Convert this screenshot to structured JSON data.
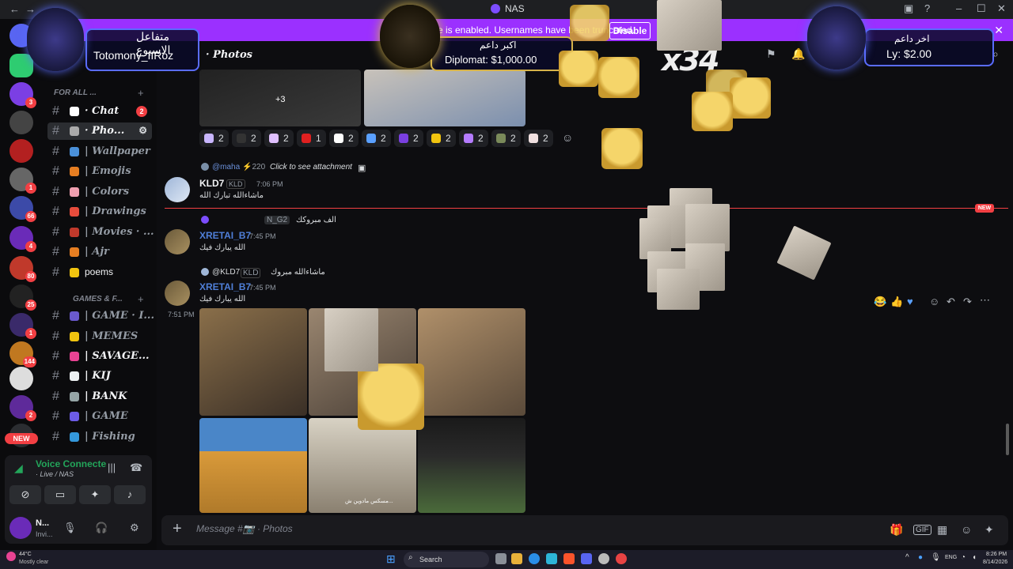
{
  "titlebar": {
    "back": "←",
    "forward": "→",
    "app_name": "NAS",
    "minimize": "–",
    "maximize": "☐",
    "close": "✕"
  },
  "banner": {
    "text": "e is enabled. Usernames have been truncated.",
    "button": "Disable",
    "close": "✕"
  },
  "rail": {
    "servers": [
      {
        "badge": "",
        "color": "#5865f2"
      },
      {
        "badge": "",
        "color": "#2ecc71"
      },
      {
        "badge": "3",
        "color": "#7b3fe4"
      },
      {
        "badge": "",
        "color": "#444444"
      },
      {
        "badge": "",
        "color": "#b32020"
      },
      {
        "badge": "1",
        "color": "#666666"
      },
      {
        "badge": "66",
        "color": "#3c4aa8"
      },
      {
        "badge": "4",
        "color": "#6a2bb8"
      },
      {
        "badge": "80",
        "color": "#c0392b"
      },
      {
        "badge": "25",
        "color": "#222222"
      },
      {
        "badge": "1",
        "color": "#3a2a6a"
      },
      {
        "badge": "144",
        "color": "#c07820"
      },
      {
        "badge": "",
        "color": "#dddddd"
      },
      {
        "badge": "2",
        "color": "#5e2a9a"
      },
      {
        "badge": "",
        "color": "#2b2d31"
      }
    ],
    "new_label": "NEW"
  },
  "sidebar": {
    "cat1": "FOR ALL ...",
    "cat2": "GAMES & F...",
    "plus": "+",
    "channels": [
      {
        "label": "· Chat",
        "badge": "2",
        "emo": "#ffffff"
      },
      {
        "label": "· Pho...",
        "badge": "",
        "emo": "#aaaaaa"
      },
      {
        "label": "| Wallpaper",
        "badge": "",
        "emo": "#4a90d9"
      },
      {
        "label": "| Emojis",
        "badge": "",
        "emo": "#e67e22"
      },
      {
        "label": "| Colors",
        "badge": "",
        "emo": "#f0a0b0"
      },
      {
        "label": "| Drawings",
        "badge": "",
        "emo": "#e74c3c"
      },
      {
        "label": "| Movies · ...",
        "badge": "",
        "emo": "#c0392b"
      },
      {
        "label": "| Ajr",
        "badge": "",
        "emo": "#e67e22"
      },
      {
        "label": "poems",
        "badge": "",
        "emo": "#f1c40f"
      },
      {
        "label": "| GAME · I...",
        "badge": "",
        "emo": "#6a5acd"
      },
      {
        "label": "| MEMES",
        "badge": "",
        "emo": "#f1c40f"
      },
      {
        "label": "| SAVAGE...",
        "badge": "",
        "emo": "#e84393"
      },
      {
        "label": "| KIJ",
        "badge": "",
        "emo": "#ecf0f1"
      },
      {
        "label": "| BANK",
        "badge": "",
        "emo": "#95a5a6"
      },
      {
        "label": "| GAME",
        "badge": "",
        "emo": "#6c5ce7"
      },
      {
        "label": "| Fishing",
        "badge": "",
        "emo": "#3498db"
      }
    ]
  },
  "voice": {
    "status": "Voice Connecte",
    "channel": "· Live / NAS",
    "user_name": "N...",
    "user_status": "Invi..."
  },
  "header": {
    "channel": "· Photos"
  },
  "reactions": [
    {
      "count": "2",
      "color": "#c9b6ff"
    },
    {
      "count": "2",
      "color": "#333333"
    },
    {
      "count": "2",
      "color": "#e0c0ff"
    },
    {
      "count": "1",
      "color": "#e02020"
    },
    {
      "count": "2",
      "color": "#ffffff"
    },
    {
      "count": "2",
      "color": "#5aa0ff"
    },
    {
      "count": "2",
      "color": "#7a3fe0"
    },
    {
      "count": "2",
      "color": "#f1c40f"
    },
    {
      "count": "2",
      "color": "#b57cff"
    },
    {
      "count": "2",
      "color": "#7a8a5a"
    },
    {
      "count": "2",
      "color": "#f0e0e0"
    }
  ],
  "messages": {
    "m1_reply_user": "@maha",
    "m1_reply_badge": "⚡220",
    "m1_reply_text": "Click to see attachment",
    "m1_user": "KLD7",
    "m1_tag": "KLD",
    "m1_time": "7:06 PM",
    "m1_text": "ماشاءالله تبارك الله",
    "m2_reply_tag": "N_G2",
    "m2_reply_text": "الف مبروكك",
    "m2_user": "XRETAI_B7",
    "m2_time": "7:45 PM",
    "m2_text": "الله يبارك فيك",
    "m3_reply_user": "@KLD7",
    "m3_reply_tag": "KLD",
    "m3_reply_text": "ماشاءالله مبروك",
    "m3_user": "XRETAI_B7",
    "m3_time": "7:45 PM",
    "m3_text": "الله يبارك فيك",
    "m4_time": "7:51 PM",
    "image_caption": "مسكس مادوين ش...",
    "new_label": "NEW",
    "plus3": "+3"
  },
  "composer": {
    "placeholder": "Message #📷 · Photos"
  },
  "overlays": {
    "weekly_label": "متفاعل الاسبوع",
    "weekly_user": "Totomony_IIRoz",
    "top_label": "اكبر داعم",
    "top_value": "Diplomat: $1,000.00",
    "last_label": "اخر داعم",
    "last_value": "Ly: $2.00",
    "multiplier": "x34"
  },
  "taskbar": {
    "weather_temp": "44°C",
    "weather_desc": "Mostly clear",
    "search": "Search",
    "lang": "ENG",
    "time": "8:26 PM",
    "date": "8/14/2026"
  }
}
